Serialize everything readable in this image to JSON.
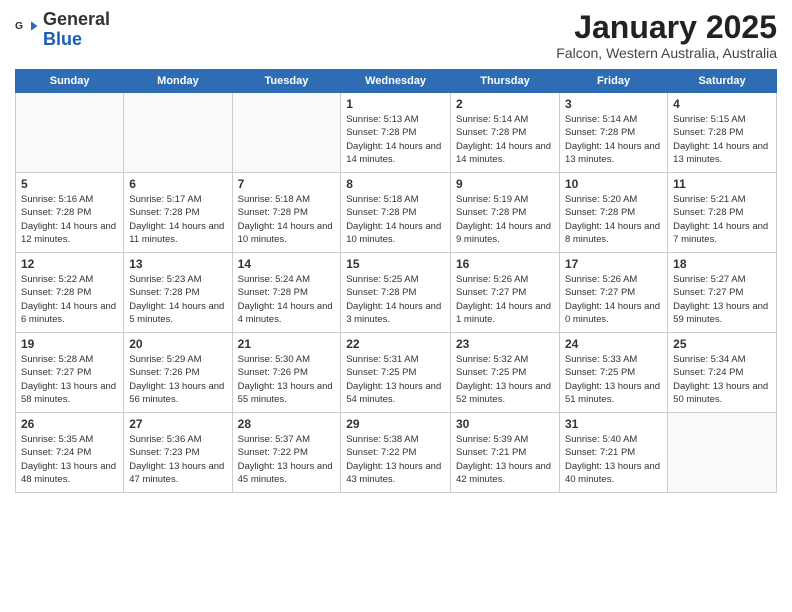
{
  "logo": {
    "general": "General",
    "blue": "Blue"
  },
  "header": {
    "month": "January 2025",
    "location": "Falcon, Western Australia, Australia"
  },
  "weekdays": [
    "Sunday",
    "Monday",
    "Tuesday",
    "Wednesday",
    "Thursday",
    "Friday",
    "Saturday"
  ],
  "weeks": [
    [
      {
        "day": "",
        "sunrise": "",
        "sunset": "",
        "daylight": "",
        "empty": true
      },
      {
        "day": "",
        "sunrise": "",
        "sunset": "",
        "daylight": "",
        "empty": true
      },
      {
        "day": "",
        "sunrise": "",
        "sunset": "",
        "daylight": "",
        "empty": true
      },
      {
        "day": "1",
        "sunrise": "Sunrise: 5:13 AM",
        "sunset": "Sunset: 7:28 PM",
        "daylight": "Daylight: 14 hours and 14 minutes."
      },
      {
        "day": "2",
        "sunrise": "Sunrise: 5:14 AM",
        "sunset": "Sunset: 7:28 PM",
        "daylight": "Daylight: 14 hours and 14 minutes."
      },
      {
        "day": "3",
        "sunrise": "Sunrise: 5:14 AM",
        "sunset": "Sunset: 7:28 PM",
        "daylight": "Daylight: 14 hours and 13 minutes."
      },
      {
        "day": "4",
        "sunrise": "Sunrise: 5:15 AM",
        "sunset": "Sunset: 7:28 PM",
        "daylight": "Daylight: 14 hours and 13 minutes."
      }
    ],
    [
      {
        "day": "5",
        "sunrise": "Sunrise: 5:16 AM",
        "sunset": "Sunset: 7:28 PM",
        "daylight": "Daylight: 14 hours and 12 minutes."
      },
      {
        "day": "6",
        "sunrise": "Sunrise: 5:17 AM",
        "sunset": "Sunset: 7:28 PM",
        "daylight": "Daylight: 14 hours and 11 minutes."
      },
      {
        "day": "7",
        "sunrise": "Sunrise: 5:18 AM",
        "sunset": "Sunset: 7:28 PM",
        "daylight": "Daylight: 14 hours and 10 minutes."
      },
      {
        "day": "8",
        "sunrise": "Sunrise: 5:18 AM",
        "sunset": "Sunset: 7:28 PM",
        "daylight": "Daylight: 14 hours and 10 minutes."
      },
      {
        "day": "9",
        "sunrise": "Sunrise: 5:19 AM",
        "sunset": "Sunset: 7:28 PM",
        "daylight": "Daylight: 14 hours and 9 minutes."
      },
      {
        "day": "10",
        "sunrise": "Sunrise: 5:20 AM",
        "sunset": "Sunset: 7:28 PM",
        "daylight": "Daylight: 14 hours and 8 minutes."
      },
      {
        "day": "11",
        "sunrise": "Sunrise: 5:21 AM",
        "sunset": "Sunset: 7:28 PM",
        "daylight": "Daylight: 14 hours and 7 minutes."
      }
    ],
    [
      {
        "day": "12",
        "sunrise": "Sunrise: 5:22 AM",
        "sunset": "Sunset: 7:28 PM",
        "daylight": "Daylight: 14 hours and 6 minutes."
      },
      {
        "day": "13",
        "sunrise": "Sunrise: 5:23 AM",
        "sunset": "Sunset: 7:28 PM",
        "daylight": "Daylight: 14 hours and 5 minutes."
      },
      {
        "day": "14",
        "sunrise": "Sunrise: 5:24 AM",
        "sunset": "Sunset: 7:28 PM",
        "daylight": "Daylight: 14 hours and 4 minutes."
      },
      {
        "day": "15",
        "sunrise": "Sunrise: 5:25 AM",
        "sunset": "Sunset: 7:28 PM",
        "daylight": "Daylight: 14 hours and 3 minutes."
      },
      {
        "day": "16",
        "sunrise": "Sunrise: 5:26 AM",
        "sunset": "Sunset: 7:27 PM",
        "daylight": "Daylight: 14 hours and 1 minute."
      },
      {
        "day": "17",
        "sunrise": "Sunrise: 5:26 AM",
        "sunset": "Sunset: 7:27 PM",
        "daylight": "Daylight: 14 hours and 0 minutes."
      },
      {
        "day": "18",
        "sunrise": "Sunrise: 5:27 AM",
        "sunset": "Sunset: 7:27 PM",
        "daylight": "Daylight: 13 hours and 59 minutes."
      }
    ],
    [
      {
        "day": "19",
        "sunrise": "Sunrise: 5:28 AM",
        "sunset": "Sunset: 7:27 PM",
        "daylight": "Daylight: 13 hours and 58 minutes."
      },
      {
        "day": "20",
        "sunrise": "Sunrise: 5:29 AM",
        "sunset": "Sunset: 7:26 PM",
        "daylight": "Daylight: 13 hours and 56 minutes."
      },
      {
        "day": "21",
        "sunrise": "Sunrise: 5:30 AM",
        "sunset": "Sunset: 7:26 PM",
        "daylight": "Daylight: 13 hours and 55 minutes."
      },
      {
        "day": "22",
        "sunrise": "Sunrise: 5:31 AM",
        "sunset": "Sunset: 7:25 PM",
        "daylight": "Daylight: 13 hours and 54 minutes."
      },
      {
        "day": "23",
        "sunrise": "Sunrise: 5:32 AM",
        "sunset": "Sunset: 7:25 PM",
        "daylight": "Daylight: 13 hours and 52 minutes."
      },
      {
        "day": "24",
        "sunrise": "Sunrise: 5:33 AM",
        "sunset": "Sunset: 7:25 PM",
        "daylight": "Daylight: 13 hours and 51 minutes."
      },
      {
        "day": "25",
        "sunrise": "Sunrise: 5:34 AM",
        "sunset": "Sunset: 7:24 PM",
        "daylight": "Daylight: 13 hours and 50 minutes."
      }
    ],
    [
      {
        "day": "26",
        "sunrise": "Sunrise: 5:35 AM",
        "sunset": "Sunset: 7:24 PM",
        "daylight": "Daylight: 13 hours and 48 minutes."
      },
      {
        "day": "27",
        "sunrise": "Sunrise: 5:36 AM",
        "sunset": "Sunset: 7:23 PM",
        "daylight": "Daylight: 13 hours and 47 minutes."
      },
      {
        "day": "28",
        "sunrise": "Sunrise: 5:37 AM",
        "sunset": "Sunset: 7:22 PM",
        "daylight": "Daylight: 13 hours and 45 minutes."
      },
      {
        "day": "29",
        "sunrise": "Sunrise: 5:38 AM",
        "sunset": "Sunset: 7:22 PM",
        "daylight": "Daylight: 13 hours and 43 minutes."
      },
      {
        "day": "30",
        "sunrise": "Sunrise: 5:39 AM",
        "sunset": "Sunset: 7:21 PM",
        "daylight": "Daylight: 13 hours and 42 minutes."
      },
      {
        "day": "31",
        "sunrise": "Sunrise: 5:40 AM",
        "sunset": "Sunset: 7:21 PM",
        "daylight": "Daylight: 13 hours and 40 minutes."
      },
      {
        "day": "",
        "sunrise": "",
        "sunset": "",
        "daylight": "",
        "empty": true
      }
    ]
  ]
}
